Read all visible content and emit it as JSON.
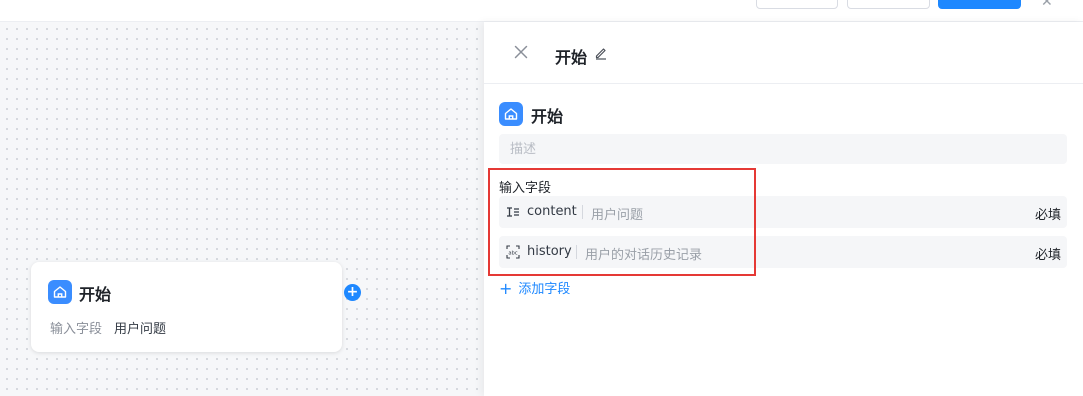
{
  "canvas": {
    "node": {
      "icon": "home-icon",
      "title": "开始",
      "field_label": "输入字段",
      "field_value": "用户问题"
    },
    "add_handle_icon": "plus-circle-icon",
    "add_handle_glyph": "+"
  },
  "panel": {
    "close_icon": "close-icon",
    "title": "开始",
    "edit_icon": "pencil-icon",
    "section_icon": "home-icon",
    "section_title": "开始",
    "description_placeholder": "描述",
    "description_value": "",
    "fields_label": "输入字段",
    "fields": [
      {
        "icon": "text-field-icon",
        "name": "content",
        "description": "用户问题",
        "required": "必填"
      },
      {
        "icon": "abc-field-icon",
        "name": "history",
        "description": "用户的对话历史记录",
        "required": "必填"
      }
    ],
    "add_field": {
      "icon": "plus-icon",
      "glyph": "+",
      "label": "添加字段"
    }
  },
  "colors": {
    "accent": "#1e88ff",
    "node_icon_bg": "#3a8dff",
    "highlight": "#e53935",
    "canvas_bg": "#f6f7f9"
  }
}
